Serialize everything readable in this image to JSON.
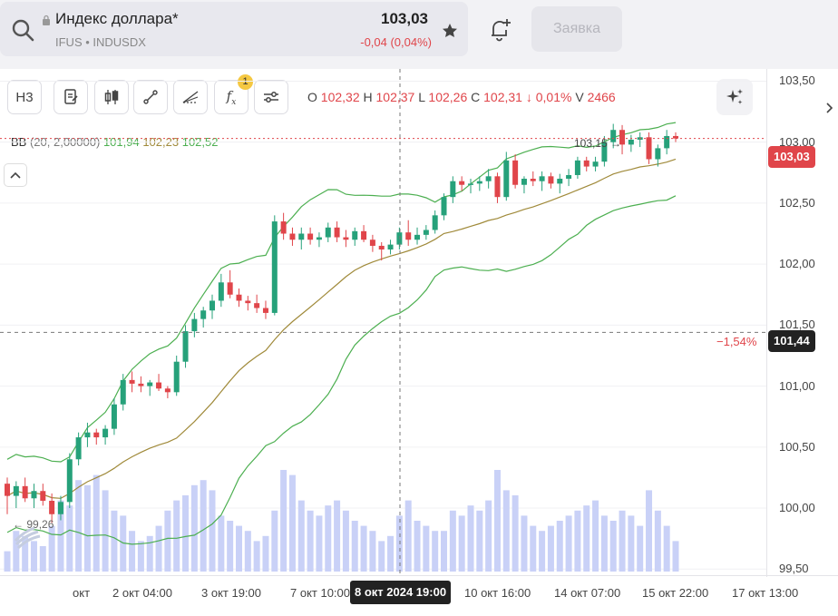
{
  "header": {
    "title": "Индекс доллара*",
    "subtitle": "IFUS • INDUSDX",
    "price": "103,03",
    "change": "-0,04 (0,04%)",
    "order_button": "Заявка"
  },
  "toolbar": {
    "timeframe": "H3",
    "indicators_badge": "1",
    "ohlc": {
      "o_label": "O",
      "o": "102,32",
      "h_label": "H",
      "h": "102,37",
      "l_label": "L",
      "l": "102,26",
      "c_label": "C",
      "c": "102,31",
      "chg": "↓ 0,01%",
      "v_label": "V",
      "v": "2466"
    }
  },
  "indicator": {
    "name": "BB",
    "params": "(20, 2,00000)",
    "upper": "101,94",
    "middle": "102,23",
    "lower": "102,52"
  },
  "price_axis": {
    "labels": [
      "103,50",
      "103,00",
      "102,50",
      "102,00",
      "101,50",
      "101,00",
      "100,50",
      "100,00",
      "99,50"
    ],
    "current_price": "103,03",
    "crosshair_price": "101,44",
    "crosshair_pct": "−1,54%",
    "high_marker": "103,15",
    "low_marker": "99,26"
  },
  "time_axis": {
    "labels": [
      "окт",
      "2 окт 04:00",
      "3 окт 19:00",
      "7 окт 10:00",
      "10 окт 16:00",
      "14 окт 07:00",
      "15 окт 22:00",
      "17 окт 13:00"
    ],
    "crosshair_time": "8 окт 2024 19:00"
  },
  "colors": {
    "up": "#26a17a",
    "down": "#e0454a",
    "bb_band": "#4caf50",
    "bb_mid": "#a08a3a",
    "volume": "#c9d1f7",
    "accent_red": "#e0454a"
  },
  "chart_data": {
    "type": "candlestick",
    "ylim": [
      99.45,
      103.6
    ],
    "candles": [
      [
        100.2,
        100.25,
        99.95,
        100.1
      ],
      [
        100.1,
        100.22,
        100.0,
        100.18
      ],
      [
        100.18,
        100.25,
        100.05,
        100.08
      ],
      [
        100.08,
        100.2,
        100.0,
        100.14
      ],
      [
        100.14,
        100.2,
        100.02,
        100.06
      ],
      [
        100.06,
        100.12,
        99.88,
        99.95
      ],
      [
        99.95,
        100.1,
        99.9,
        100.05
      ],
      [
        100.05,
        100.45,
        100.0,
        100.4
      ],
      [
        100.4,
        100.62,
        100.35,
        100.58
      ],
      [
        100.58,
        100.7,
        100.5,
        100.62
      ],
      [
        100.62,
        100.65,
        100.52,
        100.58
      ],
      [
        100.58,
        100.68,
        100.52,
        100.65
      ],
      [
        100.65,
        100.9,
        100.6,
        100.85
      ],
      [
        100.85,
        101.1,
        100.8,
        101.05
      ],
      [
        101.05,
        101.12,
        100.95,
        101.02
      ],
      [
        101.02,
        101.08,
        100.95,
        101.0
      ],
      [
        101.0,
        101.05,
        100.92,
        101.03
      ],
      [
        101.03,
        101.1,
        100.96,
        100.98
      ],
      [
        100.98,
        101.0,
        100.9,
        100.95
      ],
      [
        100.95,
        101.25,
        100.92,
        101.2
      ],
      [
        101.2,
        101.5,
        101.15,
        101.45
      ],
      [
        101.45,
        101.6,
        101.4,
        101.55
      ],
      [
        101.55,
        101.65,
        101.48,
        101.62
      ],
      [
        101.62,
        101.75,
        101.55,
        101.7
      ],
      [
        101.7,
        101.92,
        101.65,
        101.85
      ],
      [
        101.85,
        101.95,
        101.72,
        101.75
      ],
      [
        101.75,
        101.8,
        101.65,
        101.7
      ],
      [
        101.7,
        101.74,
        101.62,
        101.68
      ],
      [
        101.68,
        101.75,
        101.6,
        101.64
      ],
      [
        101.64,
        101.7,
        101.55,
        101.6
      ],
      [
        101.6,
        102.4,
        101.58,
        102.35
      ],
      [
        102.35,
        102.42,
        102.2,
        102.25
      ],
      [
        102.25,
        102.3,
        102.15,
        102.2
      ],
      [
        102.2,
        102.3,
        102.12,
        102.25
      ],
      [
        102.25,
        102.3,
        102.16,
        102.2
      ],
      [
        102.2,
        102.26,
        102.14,
        102.22
      ],
      [
        102.22,
        102.34,
        102.18,
        102.3
      ],
      [
        102.3,
        102.35,
        102.18,
        102.22
      ],
      [
        102.22,
        102.28,
        102.14,
        102.2
      ],
      [
        102.2,
        102.3,
        102.15,
        102.27
      ],
      [
        102.27,
        102.32,
        102.18,
        102.2
      ],
      [
        102.2,
        102.24,
        102.1,
        102.15
      ],
      [
        102.15,
        102.18,
        102.03,
        102.12
      ],
      [
        102.12,
        102.2,
        102.08,
        102.16
      ],
      [
        102.16,
        102.3,
        102.12,
        102.26
      ],
      [
        102.26,
        102.36,
        102.15,
        102.2
      ],
      [
        102.2,
        102.3,
        102.16,
        102.24
      ],
      [
        102.24,
        102.32,
        102.2,
        102.28
      ],
      [
        102.28,
        102.44,
        102.25,
        102.4
      ],
      [
        102.4,
        102.58,
        102.36,
        102.55
      ],
      [
        102.55,
        102.72,
        102.5,
        102.68
      ],
      [
        102.68,
        102.72,
        102.6,
        102.65
      ],
      [
        102.65,
        102.7,
        102.58,
        102.66
      ],
      [
        102.66,
        102.72,
        102.6,
        102.68
      ],
      [
        102.68,
        102.78,
        102.62,
        102.72
      ],
      [
        102.72,
        102.75,
        102.5,
        102.55
      ],
      [
        102.55,
        102.92,
        102.52,
        102.85
      ],
      [
        102.85,
        102.9,
        102.62,
        102.65
      ],
      [
        102.65,
        102.72,
        102.58,
        102.7
      ],
      [
        102.7,
        102.76,
        102.64,
        102.68
      ],
      [
        102.68,
        102.76,
        102.6,
        102.72
      ],
      [
        102.72,
        102.75,
        102.62,
        102.66
      ],
      [
        102.66,
        102.74,
        102.58,
        102.7
      ],
      [
        102.7,
        102.78,
        102.64,
        102.73
      ],
      [
        102.73,
        102.88,
        102.7,
        102.85
      ],
      [
        102.85,
        102.88,
        102.76,
        102.8
      ],
      [
        102.8,
        102.88,
        102.76,
        102.84
      ],
      [
        102.84,
        103.05,
        102.8,
        103.0
      ],
      [
        103.0,
        103.15,
        102.95,
        103.1
      ],
      [
        103.1,
        103.14,
        102.9,
        102.98
      ],
      [
        102.98,
        103.06,
        102.92,
        103.02
      ],
      [
        103.02,
        103.08,
        102.96,
        103.04
      ],
      [
        103.04,
        103.08,
        102.82,
        102.86
      ],
      [
        102.86,
        102.98,
        102.8,
        102.95
      ],
      [
        102.95,
        103.1,
        102.9,
        103.05
      ],
      [
        103.05,
        103.08,
        103.0,
        103.03
      ]
    ],
    "volumes": [
      20,
      40,
      35,
      30,
      25,
      45,
      70,
      65,
      90,
      85,
      95,
      80,
      60,
      55,
      40,
      30,
      35,
      45,
      60,
      70,
      75,
      85,
      90,
      80,
      55,
      50,
      45,
      40,
      30,
      35,
      60,
      100,
      95,
      70,
      60,
      55,
      65,
      70,
      60,
      50,
      45,
      40,
      30,
      35,
      55,
      70,
      50,
      45,
      40,
      40,
      60,
      55,
      65,
      60,
      70,
      100,
      80,
      75,
      55,
      45,
      40,
      45,
      50,
      55,
      60,
      65,
      70,
      55,
      50,
      60,
      55,
      45,
      80,
      60,
      45,
      30
    ]
  }
}
